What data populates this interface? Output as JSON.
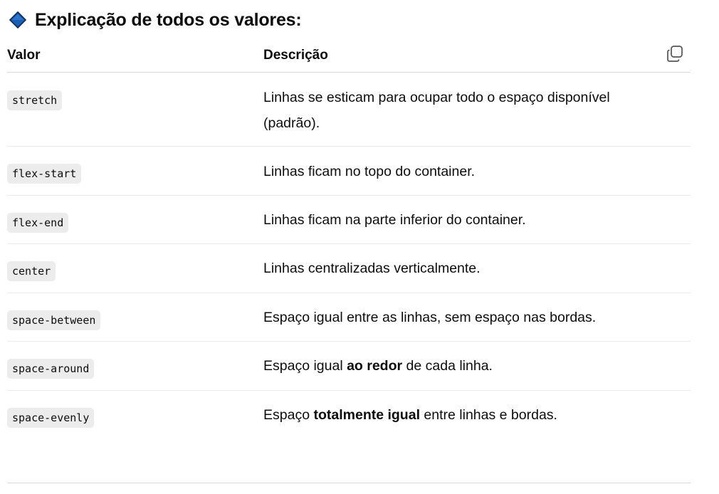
{
  "section": {
    "icon": "blue-diamond-icon",
    "title": "Explicação de todos os valores:",
    "accent_color": "#1f6fd1"
  },
  "table": {
    "headers": {
      "value": "Valor",
      "description": "Descrição"
    },
    "copy_icon": "copy-icon",
    "rows": [
      {
        "value": "stretch",
        "desc_before": "Linhas se esticam para ocupar todo o espaço disponível (padrão).",
        "desc_bold": "",
        "desc_after": ""
      },
      {
        "value": "flex-start",
        "desc_before": "Linhas ficam no topo do container.",
        "desc_bold": "",
        "desc_after": ""
      },
      {
        "value": "flex-end",
        "desc_before": "Linhas ficam na parte inferior do container.",
        "desc_bold": "",
        "desc_after": ""
      },
      {
        "value": "center",
        "desc_before": "Linhas centralizadas verticalmente.",
        "desc_bold": "",
        "desc_after": ""
      },
      {
        "value": "space-between",
        "desc_before": "Espaço igual entre as linhas, sem espaço nas bordas.",
        "desc_bold": "",
        "desc_after": ""
      },
      {
        "value": "space-around",
        "desc_before": "Espaço igual ",
        "desc_bold": "ao redor",
        "desc_after": " de cada linha."
      },
      {
        "value": "space-evenly",
        "desc_before": "Espaço ",
        "desc_bold": "totalmente igual",
        "desc_after": " entre linhas e bordas."
      }
    ]
  }
}
